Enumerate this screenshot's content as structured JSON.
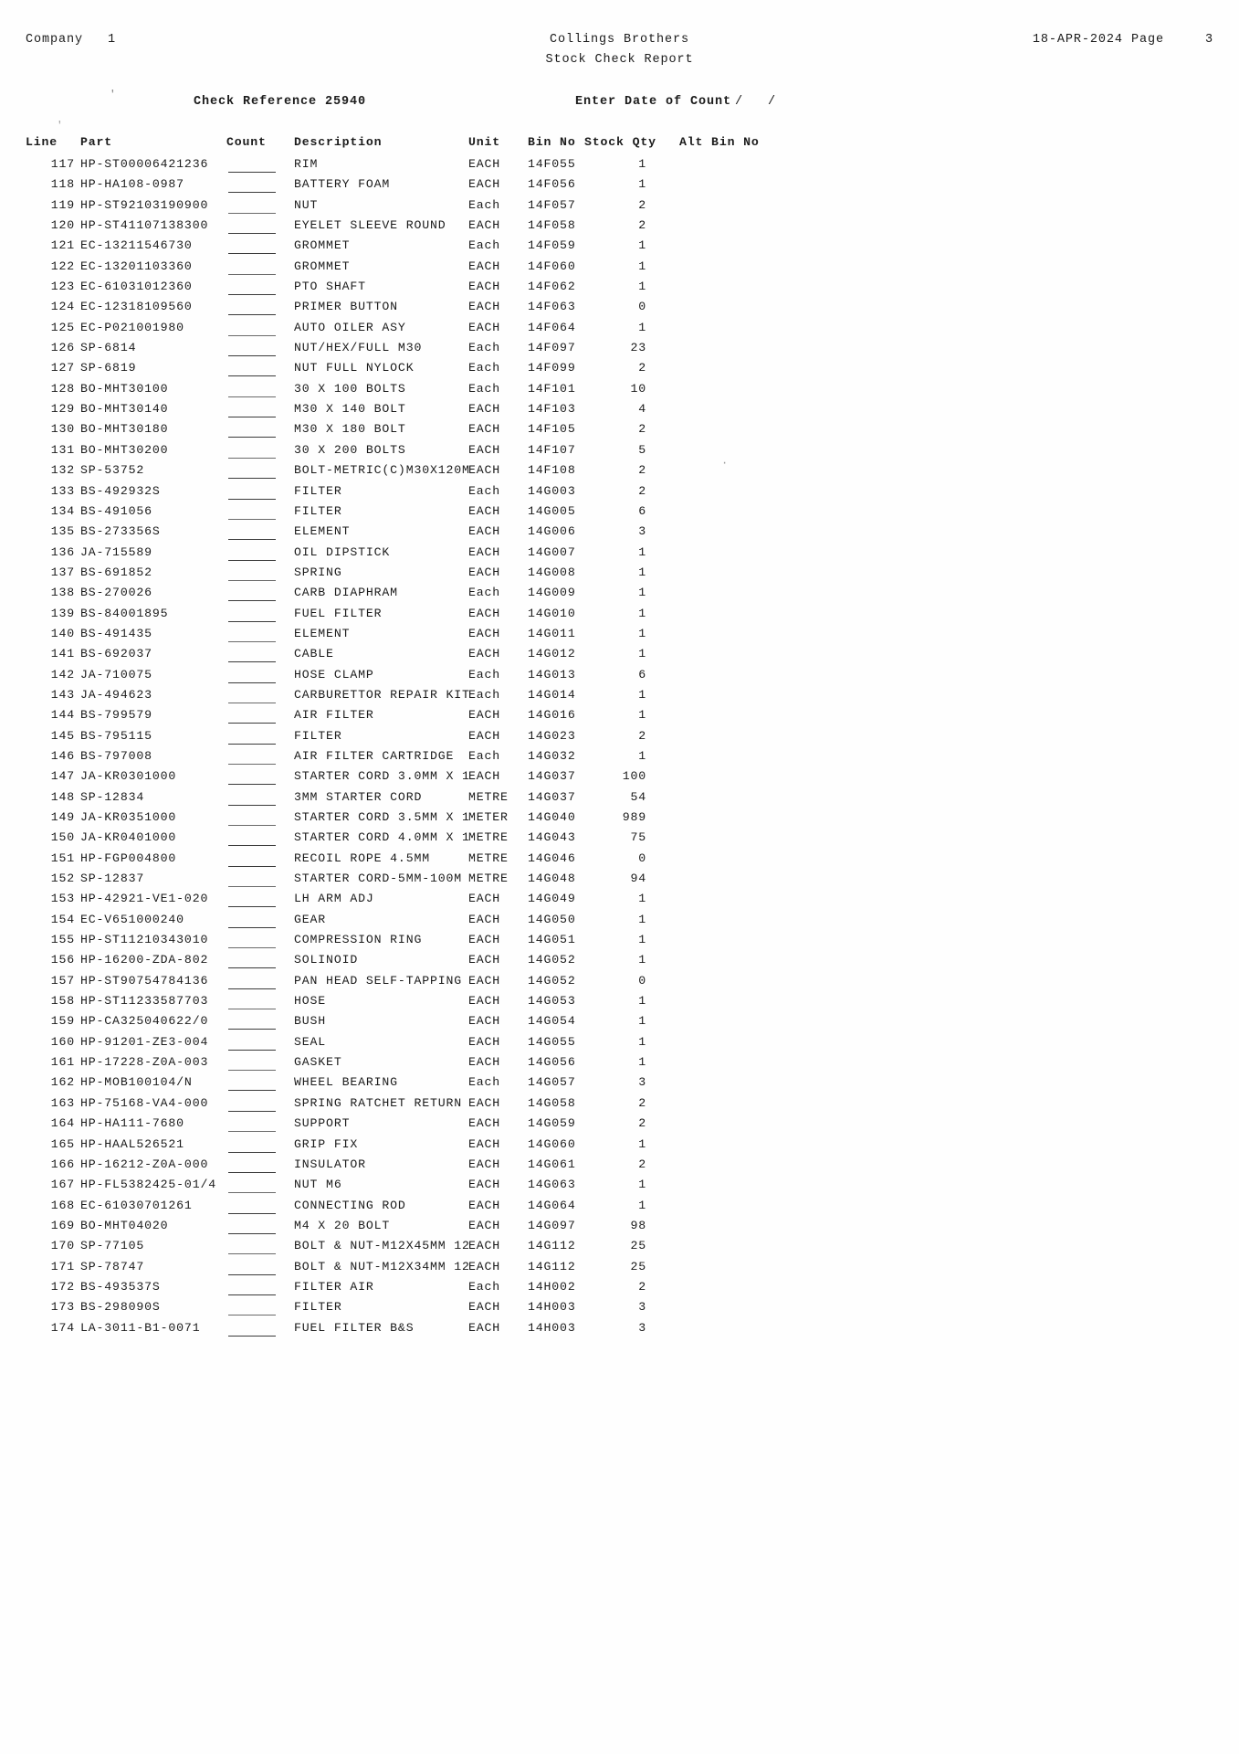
{
  "header": {
    "company_label": "Company",
    "company_value": "1",
    "title": "Collings Brothers",
    "subtitle": "Stock Check Report",
    "date": "18-APR-2024",
    "page_label": "Page",
    "page_number": "3"
  },
  "subheader": {
    "check_reference_label": "Check Reference",
    "check_reference_value": "25940",
    "enter_date_label": "Enter Date of Count",
    "slash1": "/",
    "slash2": "/"
  },
  "table": {
    "columns": {
      "line": "Line",
      "part": "Part",
      "count": "Count",
      "description": "Description",
      "unit": "Unit",
      "bin_no": "Bin No",
      "stock_qty": "Stock Qty",
      "alt_bin_no": "Alt Bin No"
    },
    "rows": [
      {
        "line": "117",
        "part": "HP-ST00006421236",
        "description": "RIM",
        "unit": "EACH",
        "bin": "14F055",
        "qty": "1",
        "alt": ""
      },
      {
        "line": "118",
        "part": "HP-HA108-0987",
        "description": "BATTERY FOAM",
        "unit": "EACH",
        "bin": "14F056",
        "qty": "1",
        "alt": ""
      },
      {
        "line": "119",
        "part": "HP-ST92103190900",
        "description": "NUT",
        "unit": "Each",
        "bin": "14F057",
        "qty": "2",
        "alt": ""
      },
      {
        "line": "120",
        "part": "HP-ST41107138300",
        "description": "EYELET SLEEVE ROUND",
        "unit": "EACH",
        "bin": "14F058",
        "qty": "2",
        "alt": ""
      },
      {
        "line": "121",
        "part": "EC-13211546730",
        "description": "GROMMET",
        "unit": "Each",
        "bin": "14F059",
        "qty": "1",
        "alt": ""
      },
      {
        "line": "122",
        "part": "EC-13201103360",
        "description": "GROMMET",
        "unit": "EACH",
        "bin": "14F060",
        "qty": "1",
        "alt": ""
      },
      {
        "line": "123",
        "part": "EC-61031012360",
        "description": "PTO SHAFT",
        "unit": "EACH",
        "bin": "14F062",
        "qty": "1",
        "alt": ""
      },
      {
        "line": "124",
        "part": "EC-12318109560",
        "description": "PRIMER BUTTON",
        "unit": "EACH",
        "bin": "14F063",
        "qty": "0",
        "alt": ""
      },
      {
        "line": "125",
        "part": "EC-P021001980",
        "description": "AUTO OILER ASY",
        "unit": "EACH",
        "bin": "14F064",
        "qty": "1",
        "alt": ""
      },
      {
        "line": "126",
        "part": "SP-6814",
        "description": "NUT/HEX/FULL M30",
        "unit": "Each",
        "bin": "14F097",
        "qty": "23",
        "alt": ""
      },
      {
        "line": "127",
        "part": "SP-6819",
        "description": "NUT FULL NYLOCK",
        "unit": "Each",
        "bin": "14F099",
        "qty": "2",
        "alt": ""
      },
      {
        "line": "128",
        "part": "BO-MHT30100",
        "description": "30 X 100 BOLTS",
        "unit": "Each",
        "bin": "14F101",
        "qty": "10",
        "alt": ""
      },
      {
        "line": "129",
        "part": "BO-MHT30140",
        "description": "M30 X 140 BOLT",
        "unit": "EACH",
        "bin": "14F103",
        "qty": "4",
        "alt": ""
      },
      {
        "line": "130",
        "part": "BO-MHT30180",
        "description": "M30 X 180 BOLT",
        "unit": "EACH",
        "bin": "14F105",
        "qty": "2",
        "alt": ""
      },
      {
        "line": "131",
        "part": "BO-MHT30200",
        "description": "30 X 200 BOLTS",
        "unit": "EACH",
        "bin": "14F107",
        "qty": "5",
        "alt": ""
      },
      {
        "line": "132",
        "part": "SP-53752",
        "description": "BOLT-METRIC(C)M30X120M",
        "unit": "EACH",
        "bin": "14F108",
        "qty": "2",
        "alt": ""
      },
      {
        "line": "133",
        "part": "BS-492932S",
        "description": "FILTER",
        "unit": "Each",
        "bin": "14G003",
        "qty": "2",
        "alt": ""
      },
      {
        "line": "134",
        "part": "BS-491056",
        "description": "FILTER",
        "unit": "EACH",
        "bin": "14G005",
        "qty": "6",
        "alt": ""
      },
      {
        "line": "135",
        "part": "BS-273356S",
        "description": "ELEMENT",
        "unit": "EACH",
        "bin": "14G006",
        "qty": "3",
        "alt": ""
      },
      {
        "line": "136",
        "part": "JA-715589",
        "description": "OIL DIPSTICK",
        "unit": "EACH",
        "bin": "14G007",
        "qty": "1",
        "alt": ""
      },
      {
        "line": "137",
        "part": "BS-691852",
        "description": "SPRING",
        "unit": "EACH",
        "bin": "14G008",
        "qty": "1",
        "alt": ""
      },
      {
        "line": "138",
        "part": "BS-270026",
        "description": "CARB DIAPHRAM",
        "unit": "Each",
        "bin": "14G009",
        "qty": "1",
        "alt": ""
      },
      {
        "line": "139",
        "part": "BS-84001895",
        "description": "FUEL FILTER",
        "unit": "EACH",
        "bin": "14G010",
        "qty": "1",
        "alt": ""
      },
      {
        "line": "140",
        "part": "BS-491435",
        "description": "ELEMENT",
        "unit": "EACH",
        "bin": "14G011",
        "qty": "1",
        "alt": ""
      },
      {
        "line": "141",
        "part": "BS-692037",
        "description": "CABLE",
        "unit": "EACH",
        "bin": "14G012",
        "qty": "1",
        "alt": ""
      },
      {
        "line": "142",
        "part": "JA-710075",
        "description": "HOSE CLAMP",
        "unit": "Each",
        "bin": "14G013",
        "qty": "6",
        "alt": ""
      },
      {
        "line": "143",
        "part": "JA-494623",
        "description": "CARBURETTOR REPAIR KIT",
        "unit": "Each",
        "bin": "14G014",
        "qty": "1",
        "alt": ""
      },
      {
        "line": "144",
        "part": "BS-799579",
        "description": "AIR FILTER",
        "unit": "EACH",
        "bin": "14G016",
        "qty": "1",
        "alt": ""
      },
      {
        "line": "145",
        "part": "BS-795115",
        "description": "FILTER",
        "unit": "EACH",
        "bin": "14G023",
        "qty": "2",
        "alt": ""
      },
      {
        "line": "146",
        "part": "BS-797008",
        "description": "AIR FILTER CARTRIDGE",
        "unit": "Each",
        "bin": "14G032",
        "qty": "1",
        "alt": ""
      },
      {
        "line": "147",
        "part": "JA-KR0301000",
        "description": "STARTER CORD 3.0MM X 1",
        "unit": "EACH",
        "bin": "14G037",
        "qty": "100",
        "alt": ""
      },
      {
        "line": "148",
        "part": "SP-12834",
        "description": "3MM STARTER CORD",
        "unit": "METRE",
        "bin": "14G037",
        "qty": "54",
        "alt": ""
      },
      {
        "line": "149",
        "part": "JA-KR0351000",
        "description": "STARTER CORD 3.5MM X 1",
        "unit": "METER",
        "bin": "14G040",
        "qty": "989",
        "alt": ""
      },
      {
        "line": "150",
        "part": "JA-KR0401000",
        "description": "STARTER CORD 4.0MM X 1",
        "unit": "METRE",
        "bin": "14G043",
        "qty": "75",
        "alt": ""
      },
      {
        "line": "151",
        "part": "HP-FGP004800",
        "description": "RECOIL ROPE 4.5MM",
        "unit": "METRE",
        "bin": "14G046",
        "qty": "0",
        "alt": ""
      },
      {
        "line": "152",
        "part": "SP-12837",
        "description": "STARTER CORD-5MM-100M",
        "unit": "METRE",
        "bin": "14G048",
        "qty": "94",
        "alt": ""
      },
      {
        "line": "153",
        "part": "HP-42921-VE1-020",
        "description": "LH ARM ADJ",
        "unit": "EACH",
        "bin": "14G049",
        "qty": "1",
        "alt": ""
      },
      {
        "line": "154",
        "part": "EC-V651000240",
        "description": "GEAR",
        "unit": "EACH",
        "bin": "14G050",
        "qty": "1",
        "alt": ""
      },
      {
        "line": "155",
        "part": "HP-ST11210343010",
        "description": "COMPRESSION RING",
        "unit": "EACH",
        "bin": "14G051",
        "qty": "1",
        "alt": ""
      },
      {
        "line": "156",
        "part": "HP-16200-ZDA-802",
        "description": "SOLINOID",
        "unit": "EACH",
        "bin": "14G052",
        "qty": "1",
        "alt": ""
      },
      {
        "line": "157",
        "part": "HP-ST90754784136",
        "description": "PAN HEAD SELF-TAPPING",
        "unit": "EACH",
        "bin": "14G052",
        "qty": "0",
        "alt": ""
      },
      {
        "line": "158",
        "part": "HP-ST11233587703",
        "description": "HOSE",
        "unit": "EACH",
        "bin": "14G053",
        "qty": "1",
        "alt": ""
      },
      {
        "line": "159",
        "part": "HP-CA325040622/0",
        "description": "BUSH",
        "unit": "EACH",
        "bin": "14G054",
        "qty": "1",
        "alt": ""
      },
      {
        "line": "160",
        "part": "HP-91201-ZE3-004",
        "description": "SEAL",
        "unit": "EACH",
        "bin": "14G055",
        "qty": "1",
        "alt": ""
      },
      {
        "line": "161",
        "part": "HP-17228-Z0A-003",
        "description": "GASKET",
        "unit": "EACH",
        "bin": "14G056",
        "qty": "1",
        "alt": ""
      },
      {
        "line": "162",
        "part": "HP-MOB100104/N",
        "description": "WHEEL BEARING",
        "unit": "Each",
        "bin": "14G057",
        "qty": "3",
        "alt": ""
      },
      {
        "line": "163",
        "part": "HP-75168-VA4-000",
        "description": "SPRING RATCHET RETURN",
        "unit": "EACH",
        "bin": "14G058",
        "qty": "2",
        "alt": ""
      },
      {
        "line": "164",
        "part": "HP-HA111-7680",
        "description": "SUPPORT",
        "unit": "EACH",
        "bin": "14G059",
        "qty": "2",
        "alt": ""
      },
      {
        "line": "165",
        "part": "HP-HAAL526521",
        "description": "GRIP FIX",
        "unit": "EACH",
        "bin": "14G060",
        "qty": "1",
        "alt": ""
      },
      {
        "line": "166",
        "part": "HP-16212-Z0A-000",
        "description": "INSULATOR",
        "unit": "EACH",
        "bin": "14G061",
        "qty": "2",
        "alt": ""
      },
      {
        "line": "167",
        "part": "HP-FL5382425-01/4",
        "description": "NUT M6",
        "unit": "EACH",
        "bin": "14G063",
        "qty": "1",
        "alt": ""
      },
      {
        "line": "168",
        "part": "EC-61030701261",
        "description": "CONNECTING ROD",
        "unit": "EACH",
        "bin": "14G064",
        "qty": "1",
        "alt": ""
      },
      {
        "line": "169",
        "part": "BO-MHT04020",
        "description": "M4 X 20 BOLT",
        "unit": "EACH",
        "bin": "14G097",
        "qty": "98",
        "alt": ""
      },
      {
        "line": "170",
        "part": "SP-77105",
        "description": "BOLT & NUT-M12X45MM 12",
        "unit": "EACH",
        "bin": "14G112",
        "qty": "25",
        "alt": ""
      },
      {
        "line": "171",
        "part": "SP-78747",
        "description": "BOLT & NUT-M12X34MM 12",
        "unit": "EACH",
        "bin": "14G112",
        "qty": "25",
        "alt": ""
      },
      {
        "line": "172",
        "part": "BS-493537S",
        "description": "FILTER AIR",
        "unit": "Each",
        "bin": "14H002",
        "qty": "2",
        "alt": ""
      },
      {
        "line": "173",
        "part": "BS-298090S",
        "description": "FILTER",
        "unit": "EACH",
        "bin": "14H003",
        "qty": "3",
        "alt": ""
      },
      {
        "line": "174",
        "part": "LA-3011-B1-0071",
        "description": "FUEL FILTER B&S",
        "unit": "EACH",
        "bin": "14H003",
        "qty": "3",
        "alt": ""
      }
    ]
  }
}
